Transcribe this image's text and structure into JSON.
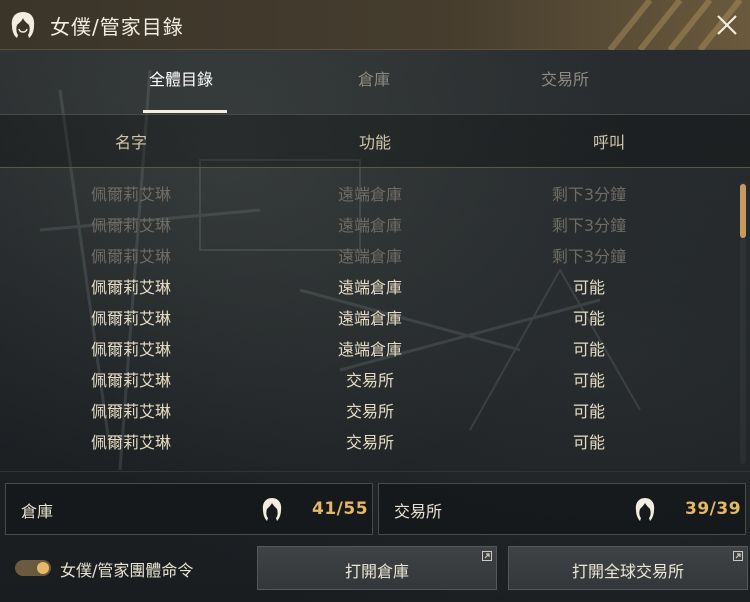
{
  "window": {
    "title": "女僕/管家目錄"
  },
  "tabs": [
    {
      "label": "全體目錄",
      "active": true
    },
    {
      "label": "倉庫",
      "active": false
    },
    {
      "label": "交易所",
      "active": false
    }
  ],
  "columns": {
    "name": "名字",
    "function": "功能",
    "call": "呼叫"
  },
  "rows": [
    {
      "name": "佩爾莉艾琳",
      "function": "遠端倉庫",
      "call": "剩下3分鐘",
      "available": false
    },
    {
      "name": "佩爾莉艾琳",
      "function": "遠端倉庫",
      "call": "剩下3分鐘",
      "available": false
    },
    {
      "name": "佩爾莉艾琳",
      "function": "遠端倉庫",
      "call": "剩下3分鐘",
      "available": false
    },
    {
      "name": "佩爾莉艾琳",
      "function": "遠端倉庫",
      "call": "可能",
      "available": true
    },
    {
      "name": "佩爾莉艾琳",
      "function": "遠端倉庫",
      "call": "可能",
      "available": true
    },
    {
      "name": "佩爾莉艾琳",
      "function": "遠端倉庫",
      "call": "可能",
      "available": true
    },
    {
      "name": "佩爾莉艾琳",
      "function": "交易所",
      "call": "可能",
      "available": true
    },
    {
      "name": "佩爾莉艾琳",
      "function": "交易所",
      "call": "可能",
      "available": true
    },
    {
      "name": "佩爾莉艾琳",
      "function": "交易所",
      "call": "可能",
      "available": true
    }
  ],
  "storage_panel": {
    "label": "倉庫",
    "count": "41/55",
    "icon": "maid-icon"
  },
  "market_panel": {
    "label": "交易所",
    "count": "39/39",
    "icon": "maid-icon"
  },
  "footer": {
    "toggle_label": "女僕/管家團體命令",
    "toggle_on": true,
    "open_storage_label": "打開倉庫",
    "open_market_label": "打開全球交易所"
  },
  "colors": {
    "accent": "#e5b866",
    "title_bar": "#463d2e",
    "text_available": "#e6dcc3",
    "text_unavailable": "#6f6c66"
  }
}
